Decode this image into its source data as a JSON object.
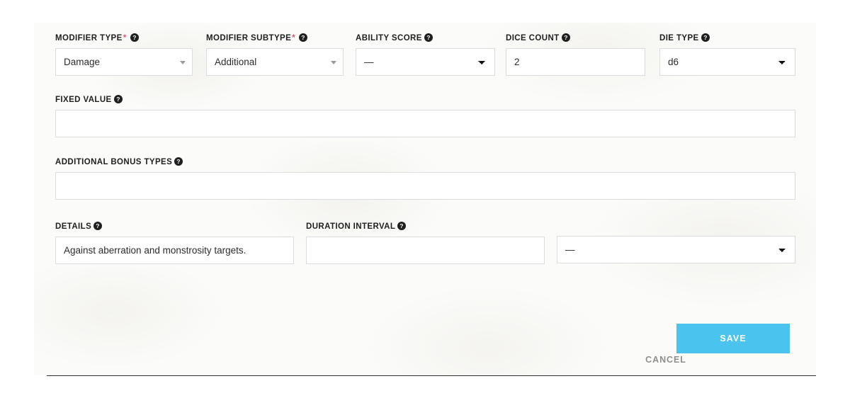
{
  "theme": {
    "card_bg": "#fbfbf9",
    "page_bg": "#ffffff",
    "shadow": "#2f2f2f",
    "label_color": "#1f1f1f",
    "input_border": "#dcdcdc",
    "required_asterisk": "#e0586d",
    "save_button_bg": "#4ac4ee",
    "cancel_text": "#8f8f8f"
  },
  "form": {
    "fields": {
      "modifier_type": {
        "label": "MODIFIER TYPE",
        "required_marker": "*",
        "help_icon": "help-circle-icon",
        "control": "combo",
        "value": "Damage"
      },
      "modifier_subtype": {
        "label": "MODIFIER SUBTYPE",
        "required_marker": "*",
        "help_icon": "help-circle-icon",
        "control": "combo",
        "value": "Additional"
      },
      "ability_score": {
        "label": "ABILITY SCORE",
        "help_icon": "help-circle-icon",
        "control": "select",
        "value": "—"
      },
      "dice_count": {
        "label": "DICE COUNT",
        "help_icon": "help-circle-icon",
        "control": "input",
        "value": "2",
        "placeholder": ""
      },
      "die_type": {
        "label": "DIE TYPE",
        "help_icon": "help-circle-icon",
        "control": "select",
        "value": "d6"
      },
      "fixed_value": {
        "label": "FIXED VALUE",
        "help_icon": "help-circle-icon",
        "control": "input",
        "value": "",
        "placeholder": ""
      },
      "additional_bonus_types": {
        "label": "ADDITIONAL BONUS TYPES",
        "help_icon": "help-circle-icon",
        "control": "input",
        "value": "",
        "placeholder": ""
      },
      "details": {
        "label": "DETAILS",
        "help_icon": "help-circle-icon",
        "control": "input",
        "value": "Against aberration and monstrosity targets.",
        "placeholder": ""
      },
      "duration_interval": {
        "label": "DURATION INTERVAL",
        "help_icon": "help-circle-icon",
        "control": "input",
        "value": "",
        "placeholder": ""
      },
      "duration_unit": {
        "label": "",
        "control": "select",
        "value": "—"
      }
    }
  },
  "footer": {
    "cancel_label": "CANCEL",
    "save_label": "SAVE"
  }
}
